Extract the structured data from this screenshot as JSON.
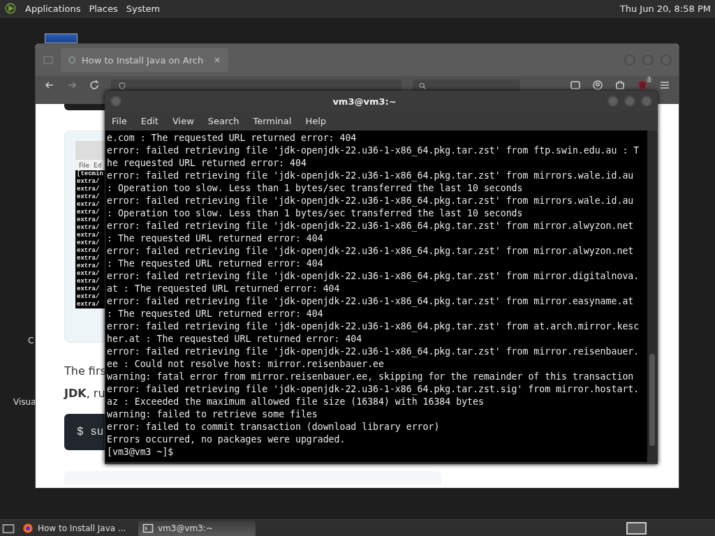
{
  "top_panel": {
    "menus": [
      "Applications",
      "Places",
      "System"
    ],
    "clock": "Thu Jun 20, 8:58 PM"
  },
  "desktop_icons": [
    {
      "label": "C"
    },
    {
      "label": "Visua"
    }
  ],
  "browser": {
    "tab": {
      "title": "How to Install Java on Arch"
    },
    "extension_badge": "3",
    "article": {
      "screenshot": {
        "menus": [
          "File",
          "Ed"
        ],
        "lines": [
          "[tecmin",
          "extra/",
          "extra/",
          "extra/",
          "extra/",
          "extra/",
          "extra/",
          "extra/",
          "extra/",
          "extra/",
          "extra/",
          "extra/",
          "extra/",
          "extra/",
          "extra/",
          "extra/",
          "extra/",
          "extra/"
        ]
      },
      "paragraph_lines": [
        "The firs",
        "**JDK**, ru"
      ],
      "code": "$ su"
    }
  },
  "terminal": {
    "title": "vm3@vm3:~",
    "menus": [
      "File",
      "Edit",
      "View",
      "Search",
      "Terminal",
      "Help"
    ],
    "lines": [
      "e.com : The requested URL returned error: 404",
      "error: failed retrieving file 'jdk-openjdk-22.u36-1-x86_64.pkg.tar.zst' from ftp.swin.edu.au : T",
      "he requested URL returned error: 404",
      "error: failed retrieving file 'jdk-openjdk-22.u36-1-x86_64.pkg.tar.zst' from mirrors.wale.id.au",
      ": Operation too slow. Less than 1 bytes/sec transferred the last 10 seconds",
      "error: failed retrieving file 'jdk-openjdk-22.u36-1-x86_64.pkg.tar.zst' from mirrors.wale.id.au",
      ": Operation too slow. Less than 1 bytes/sec transferred the last 10 seconds",
      "error: failed retrieving file 'jdk-openjdk-22.u36-1-x86_64.pkg.tar.zst' from mirror.alwyzon.net",
      ": The requested URL returned error: 404",
      "error: failed retrieving file 'jdk-openjdk-22.u36-1-x86_64.pkg.tar.zst' from mirror.alwyzon.net",
      ": The requested URL returned error: 404",
      "error: failed retrieving file 'jdk-openjdk-22.u36-1-x86_64.pkg.tar.zst' from mirror.digitalnova.",
      "at : The requested URL returned error: 404",
      "error: failed retrieving file 'jdk-openjdk-22.u36-1-x86_64.pkg.tar.zst' from mirror.easyname.at",
      ": The requested URL returned error: 404",
      "error: failed retrieving file 'jdk-openjdk-22.u36-1-x86_64.pkg.tar.zst' from at.arch.mirror.kesc",
      "her.at : The requested URL returned error: 404",
      "error: failed retrieving file 'jdk-openjdk-22.u36-1-x86_64.pkg.tar.zst' from mirror.reisenbauer.",
      "ee : Could not resolve host: mirror.reisenbauer.ee",
      "warning: fatal error from mirror.reisenbauer.ee, skipping for the remainder of this transaction",
      "error: failed retrieving file 'jdk-openjdk-22.u36-1-x86_64.pkg.tar.zst.sig' from mirror.hostart.",
      "az : Exceeded the maximum allowed file size (16384) with 16384 bytes",
      "warning: failed to retrieve some files",
      "error: failed to commit transaction (download library error)",
      "Errors occurred, no packages were upgraded.",
      "[vm3@vm3 ~]$"
    ]
  },
  "taskbar": {
    "tasks": [
      {
        "kind": "browser",
        "title": "How to Install Java ...",
        "selected": false
      },
      {
        "kind": "terminal",
        "title": "vm3@vm3:~",
        "selected": true
      }
    ]
  }
}
